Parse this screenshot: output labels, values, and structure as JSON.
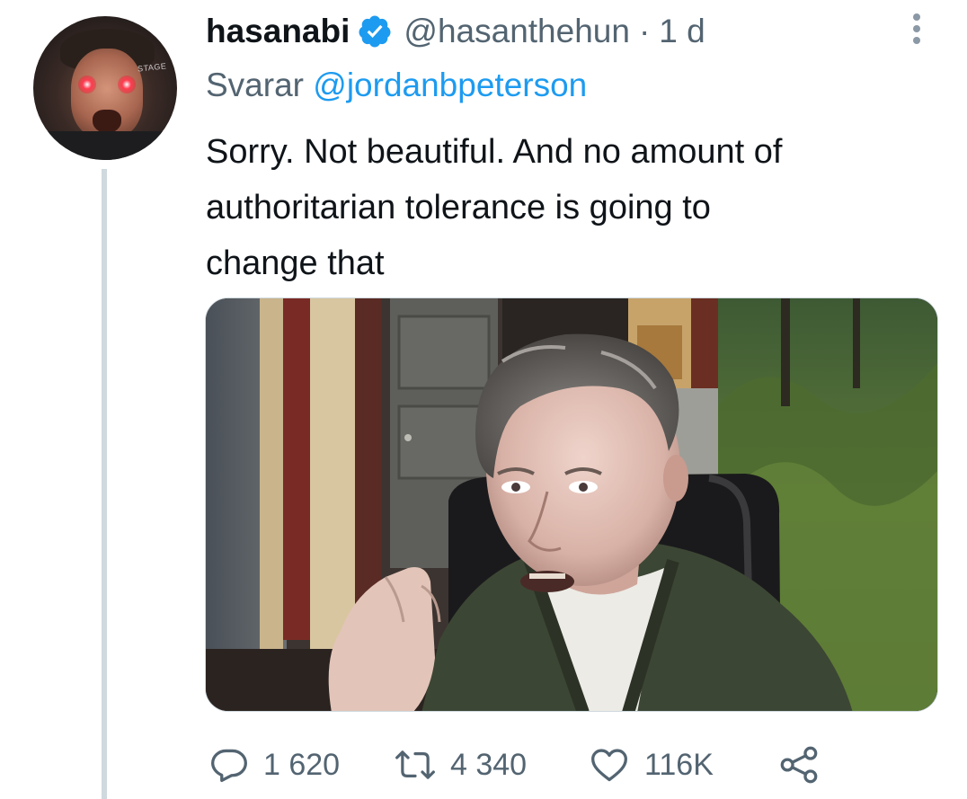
{
  "tweet": {
    "display_name": "hasanabi",
    "handle": "@hasanthehun",
    "separator": "·",
    "time": "1 d",
    "reply_prefix": "Svarar",
    "reply_mention": "@jordanbpeterson",
    "text_lines": [
      "Sorry. Not beautiful. And no amount of",
      "authoritarian tolerance is going to",
      "change that"
    ],
    "verified_icon": "verified-badge-icon",
    "more_icon": "more-vertical-icon"
  },
  "avatar": {
    "sign_text": "STAGE"
  },
  "actions": {
    "reply": {
      "icon": "reply-icon",
      "count": "1 620"
    },
    "retweet": {
      "icon": "retweet-icon",
      "count": "4 340"
    },
    "like": {
      "icon": "heart-icon",
      "count": "116K"
    },
    "share": {
      "icon": "share-icon"
    }
  },
  "colors": {
    "text": "#0f1419",
    "secondary": "#536471",
    "accent": "#1d9bf0",
    "thread_line": "#cfd9de"
  }
}
